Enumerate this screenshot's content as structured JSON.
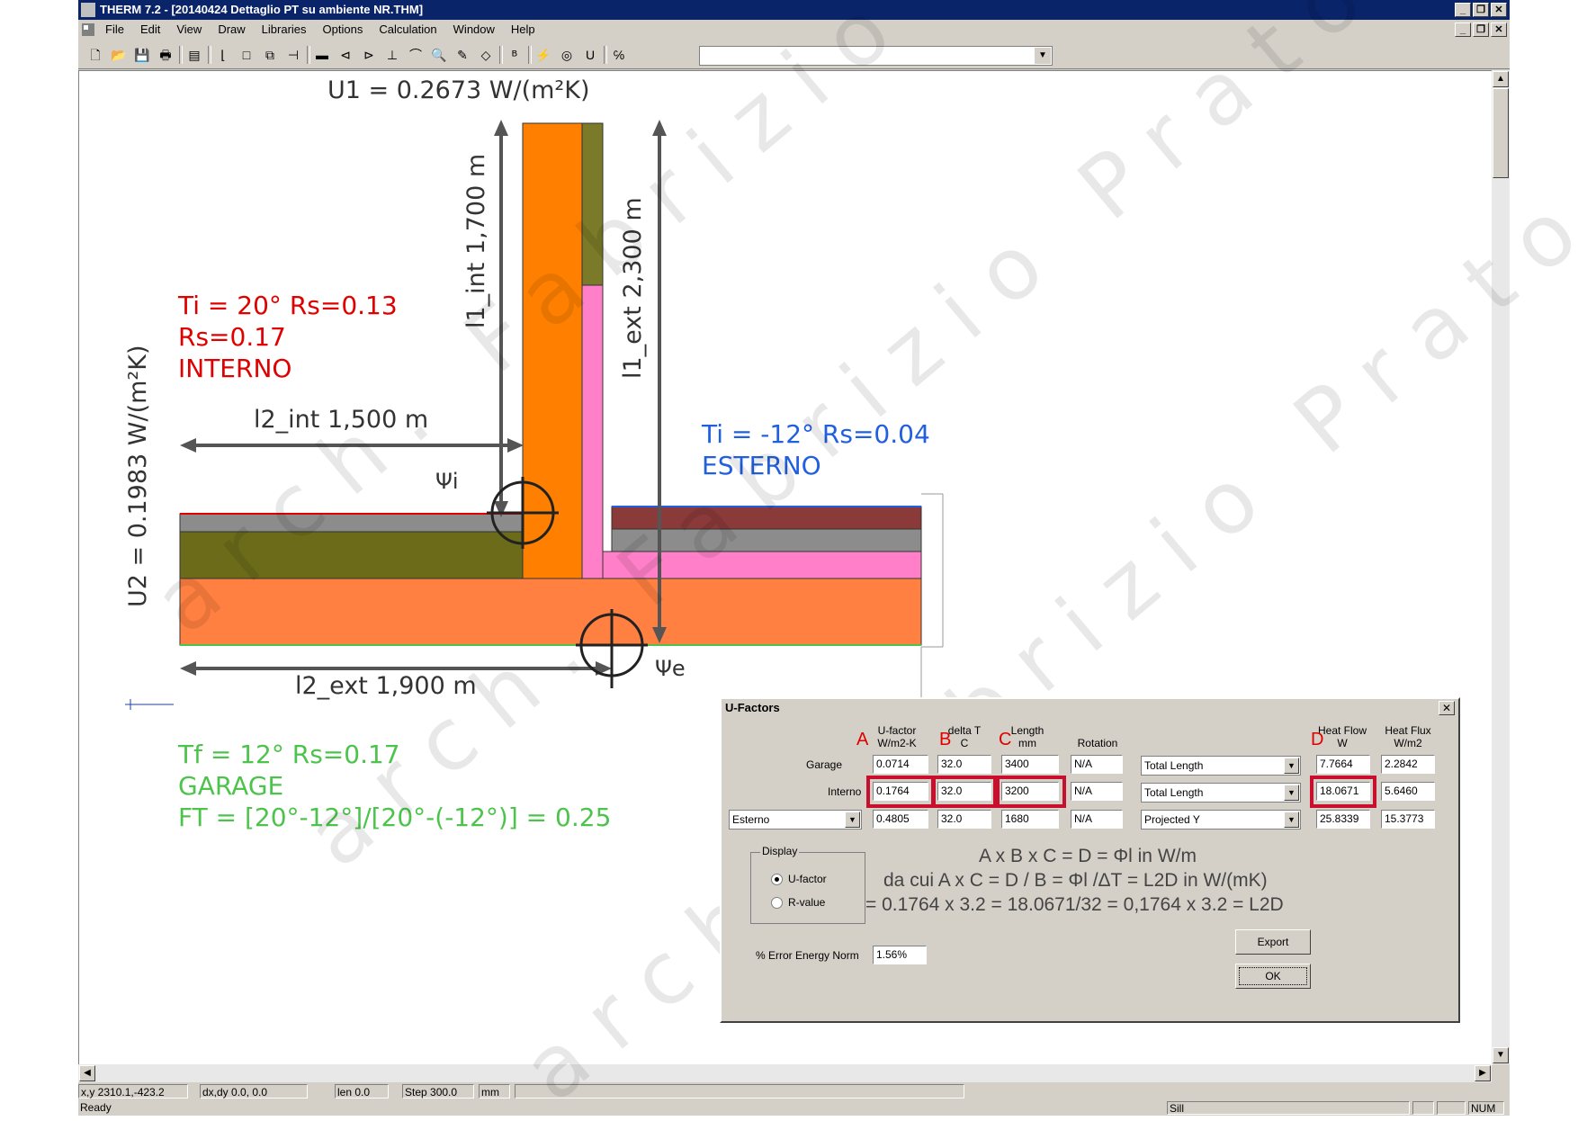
{
  "window": {
    "title": "THERM 7.2 - [20140424 Dettaglio PT su ambiente NR.THM]"
  },
  "menu": [
    "File",
    "Edit",
    "View",
    "Draw",
    "Libraries",
    "Options",
    "Calculation",
    "Window",
    "Help"
  ],
  "drawing": {
    "u1": "U1 = 0.2673 W/(m²K)",
    "u2": "U2 = 0.1983 W/(m²K)",
    "l1_int": "l1_int 1,700 m",
    "l1_ext": "l1_ext 2,300 m",
    "l2_int": "l2_int 1,500 m",
    "l2_ext": "l2_ext 1,900 m",
    "psi_i": "Ψi",
    "psi_e": "Ψe",
    "interno": [
      "Ti = 20° Rs=0.13",
      "Rs=0.17",
      "INTERNO"
    ],
    "esterno": [
      "Ti = -12° Rs=0.04",
      "ESTERNO"
    ],
    "garage": [
      "Tf = 12° Rs=0.17",
      "GARAGE"
    ],
    "ft_formula": "FT = [20°-12°]/[20°-(-12°)] = 0.25",
    "colors": {
      "red": "#e00000",
      "blue": "#1f5fe0",
      "green": "#4cc44c",
      "arrow": "#555555",
      "orange": "#ff8000",
      "olive": "#7a7a28",
      "pink": "#ff80c8",
      "gray": "#8c8c8c",
      "maroon": "#8b3a3a",
      "dkolive": "#6b6b1a",
      "floor": "#ff8040"
    }
  },
  "watermark": "arch. Fabrizio Prato",
  "dialog": {
    "title": "U-Factors",
    "headers": {
      "ufactor": [
        "U-factor",
        "W/m2-K"
      ],
      "deltat": [
        "delta T",
        "C"
      ],
      "length": [
        "Length",
        "mm"
      ],
      "rotation": "Rotation",
      "heatflow": [
        "Heat Flow",
        "W"
      ],
      "heatflux": [
        "Heat Flux",
        "W/m2"
      ]
    },
    "letters": [
      "A",
      "B",
      "C",
      "D"
    ],
    "rows": [
      {
        "name": "Garage",
        "ufactor": "0.0714",
        "deltat": "32.0",
        "length": "3400",
        "rotation": "N/A",
        "mode": "Total Length",
        "heatflow": "7.7664",
        "heatflux": "2.2842"
      },
      {
        "name": "Interno",
        "ufactor": "0.1764",
        "deltat": "32.0",
        "length": "3200",
        "rotation": "N/A",
        "mode": "Total Length",
        "heatflow": "18.0671",
        "heatflux": "5.6460"
      },
      {
        "name": "Esterno",
        "ufactor": "0.4805",
        "deltat": "32.0",
        "length": "1680",
        "rotation": "N/A",
        "mode": "Projected Y",
        "heatflow": "25.8339",
        "heatflux": "15.3773"
      }
    ],
    "display": {
      "title": "Display",
      "ufactor": "U-factor",
      "rvalue": "R-value"
    },
    "error_label": "% Error Energy Norm",
    "error_value": "1.56%",
    "export": "Export",
    "ok": "OK",
    "formula1": "A x B x C = D = Φl in W/m",
    "formula2": "da cui A x C = D / B = Φl /ΔT = L2D  in W/(mK)",
    "formula3": "= 0.1764 x 3.2 = 18.0671/32 = 0,1764 x 3.2 = L2D"
  },
  "coords": {
    "xy": "x,y 2310.1,-423.2",
    "dxdy": "dx,dy  0.0, 0.0",
    "len": "len  0.0",
    "step": "Step 300.0",
    "unit": "mm"
  },
  "status": {
    "ready": "Ready",
    "sill": "Sill",
    "num": "NUM"
  }
}
